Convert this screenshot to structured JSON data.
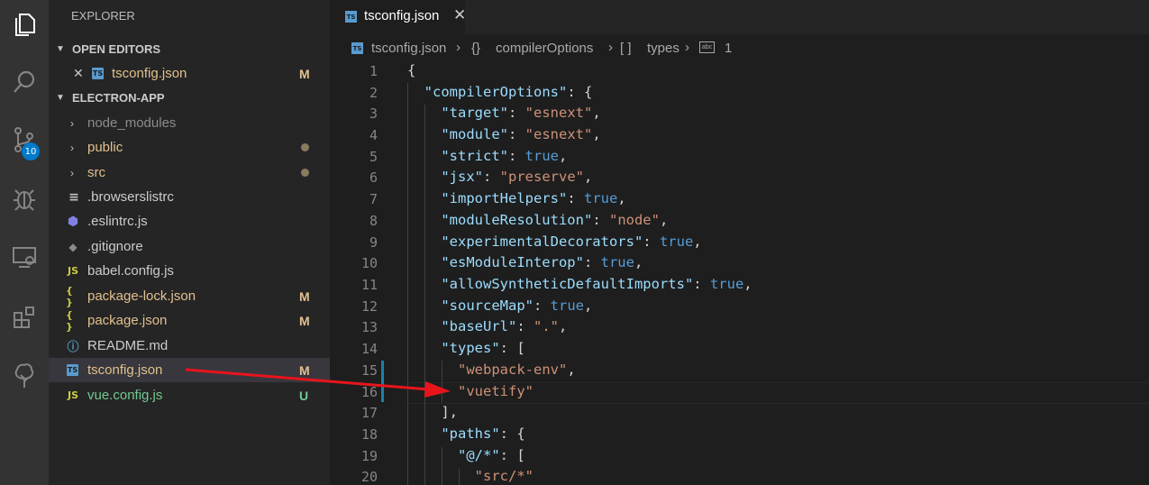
{
  "sidebar": {
    "title": "EXPLORER",
    "open_editors": {
      "header": "OPEN EDITORS",
      "items": [
        {
          "label": "tsconfig.json",
          "status": "M"
        }
      ]
    },
    "project": {
      "header": "ELECTRON-APP",
      "items": [
        {
          "label": "node_modules",
          "kind": "folder",
          "status": ""
        },
        {
          "label": "public",
          "kind": "folder",
          "status": "dot"
        },
        {
          "label": "src",
          "kind": "folder",
          "status": "dot"
        },
        {
          "label": ".browserslistrc",
          "kind": "file",
          "status": ""
        },
        {
          "label": ".eslintrc.js",
          "kind": "file",
          "status": ""
        },
        {
          "label": ".gitignore",
          "kind": "file",
          "status": ""
        },
        {
          "label": "babel.config.js",
          "kind": "file",
          "icon": "JS",
          "status": ""
        },
        {
          "label": "package-lock.json",
          "kind": "file",
          "icon": "{ }",
          "status": "M"
        },
        {
          "label": "package.json",
          "kind": "file",
          "icon": "{ }",
          "status": "M"
        },
        {
          "label": "README.md",
          "kind": "file",
          "status": ""
        },
        {
          "label": "tsconfig.json",
          "kind": "file",
          "icon": "TS",
          "status": "M"
        },
        {
          "label": "vue.config.js",
          "kind": "file",
          "icon": "JS",
          "status": "U"
        }
      ]
    }
  },
  "activity": {
    "scm_badge": "10"
  },
  "editor": {
    "tab": {
      "label": "tsconfig.json",
      "icon": "TS",
      "close": "✕"
    },
    "breadcrumb": {
      "file": "tsconfig.json",
      "level1_icon": "{}",
      "level1": "compilerOptions",
      "level2_icon": "[ ]",
      "level2": "types",
      "level3": "1"
    },
    "line_numbers": [
      "1",
      "2",
      "3",
      "4",
      "5",
      "6",
      "7",
      "8",
      "9",
      "10",
      "11",
      "12",
      "13",
      "14",
      "15",
      "16",
      "17",
      "18",
      "19",
      "20"
    ],
    "code": {
      "l1": "{",
      "l2_key": "\"compilerOptions\"",
      "l2_rest": ": {",
      "l3_key": "\"target\"",
      "l3_val": "\"esnext\"",
      "l4_key": "\"module\"",
      "l4_val": "\"esnext\"",
      "l5_key": "\"strict\"",
      "l5_val": "true",
      "l6_key": "\"jsx\"",
      "l6_val": "\"preserve\"",
      "l7_key": "\"importHelpers\"",
      "l7_val": "true",
      "l8_key": "\"moduleResolution\"",
      "l8_val": "\"node\"",
      "l9_key": "\"experimentalDecorators\"",
      "l9_val": "true",
      "l10_key": "\"esModuleInterop\"",
      "l10_val": "true",
      "l11_key": "\"allowSyntheticDefaultImports\"",
      "l11_val": "true",
      "l12_key": "\"sourceMap\"",
      "l12_val": "true",
      "l13_key": "\"baseUrl\"",
      "l13_val": "\".\"",
      "l14_key": "\"types\"",
      "l14_rest": ": [",
      "l15_val": "\"webpack-env\"",
      "l16_val": "\"vuetify\"",
      "l17": "],",
      "l18_key": "\"paths\"",
      "l18_rest": ": {",
      "l19_key": "\"@/*\"",
      "l19_rest": ": [",
      "l20_val": "\"src/*\""
    }
  },
  "colors": {
    "modified": "#e2c08d",
    "untracked": "#73c991",
    "accent": "#007acc",
    "arrow": "#e8141c"
  }
}
